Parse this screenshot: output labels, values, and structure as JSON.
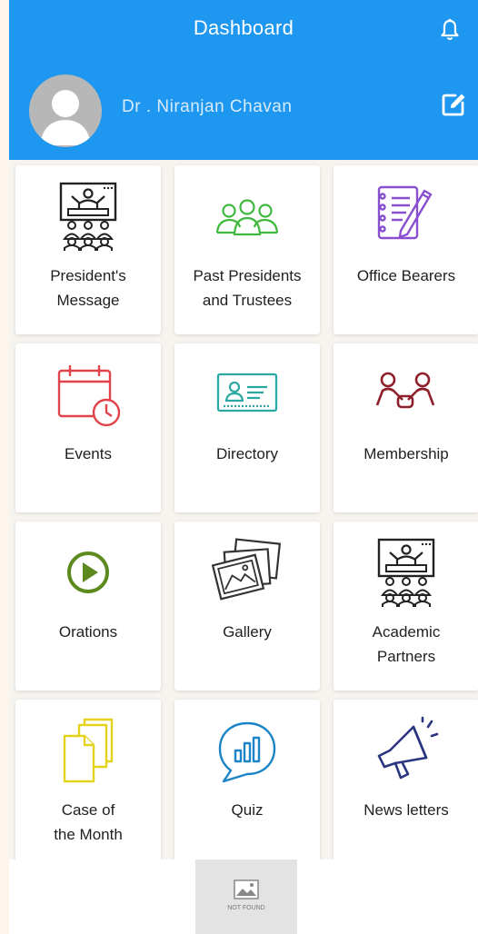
{
  "header": {
    "title": "Dashboard"
  },
  "profile": {
    "name": "Dr . Niranjan Chavan"
  },
  "tiles": [
    {
      "label": "President's\nMessage",
      "icon": "presentation-icon"
    },
    {
      "label": "Past Presidents\nand Trustees",
      "icon": "group-icon"
    },
    {
      "label": "Office Bearers",
      "icon": "notepad-pen-icon"
    },
    {
      "label": "Events",
      "icon": "calendar-clock-icon"
    },
    {
      "label": "Directory",
      "icon": "id-card-icon"
    },
    {
      "label": "Membership",
      "icon": "handshake-people-icon"
    },
    {
      "label": "Orations",
      "icon": "play-circle-icon"
    },
    {
      "label": "Gallery",
      "icon": "photo-stack-icon"
    },
    {
      "label": "Academic\nPartners",
      "icon": "presentation-icon"
    },
    {
      "label": "Case of\nthe Month",
      "icon": "document-stack-icon"
    },
    {
      "label": "Quiz",
      "icon": "chat-bar-chart-icon"
    },
    {
      "label": "News letters",
      "icon": "megaphone-icon"
    }
  ],
  "footer": {
    "image_placeholder": "NOT FOUND"
  },
  "colors": {
    "header": "#1e97f0",
    "group_green": "#3fb83f",
    "purple": "#8a4fd0",
    "red": "#e2434a",
    "teal": "#2aa9a3",
    "maroon": "#8e1f2b",
    "olive": "#5d8a1f",
    "yellow": "#e4d21c",
    "blue": "#1b84c8",
    "navy": "#2a3580"
  }
}
